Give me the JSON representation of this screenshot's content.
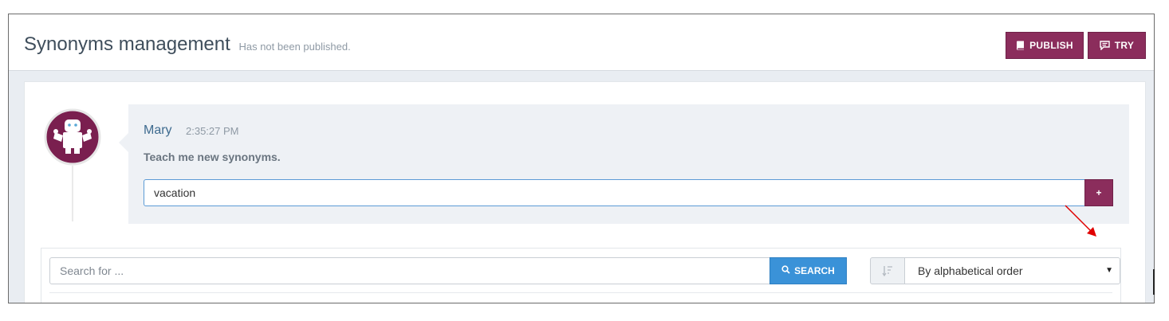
{
  "header": {
    "title": "Synonyms management",
    "subtitle": "Has not been published.",
    "publish_label": "PUBLISH",
    "try_label": "TRY"
  },
  "chat": {
    "author": "Mary",
    "time": "2:35:27 PM",
    "message": "Teach me new synonyms.",
    "input_value": "vacation",
    "add_label": "+"
  },
  "search": {
    "placeholder": "Search for ...",
    "button_label": "SEARCH",
    "sort_value": "By alphabetical order"
  },
  "colors": {
    "primary": "#8b2d5c",
    "search_button": "#3a92d8",
    "annotation_arrow": "#e00000"
  },
  "icons": {
    "publish": "book-icon",
    "try": "chat-bubble-icon",
    "search": "magnifier-icon",
    "sort": "sort-order-icon",
    "avatar": "robot-avatar"
  }
}
